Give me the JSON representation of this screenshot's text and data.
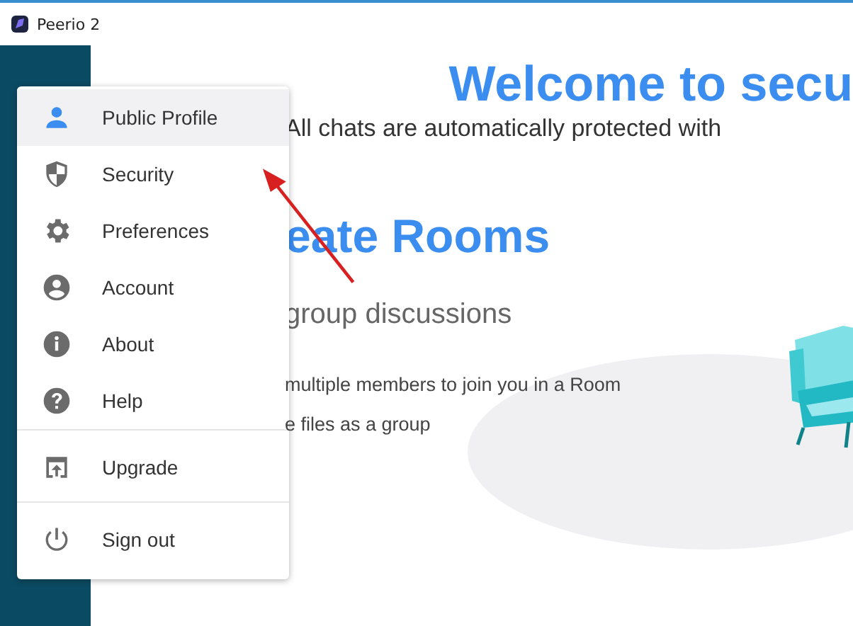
{
  "window": {
    "title": "Peerio 2"
  },
  "main": {
    "heading": "Welcome to secu",
    "subtitle": "All chats are automatically protected with",
    "section_heading": "eate Rooms",
    "section_subheading": "group discussions",
    "lines": [
      "multiple members to join you in a Room",
      "e files as a group"
    ]
  },
  "menu": {
    "sections": [
      [
        {
          "label": "Public Profile",
          "selected": true
        },
        {
          "label": "Security",
          "selected": false
        },
        {
          "label": "Preferences",
          "selected": false
        },
        {
          "label": "Account",
          "selected": false
        },
        {
          "label": "About",
          "selected": false
        },
        {
          "label": "Help",
          "selected": false
        }
      ],
      [
        {
          "label": "Upgrade",
          "selected": false
        }
      ],
      [
        {
          "label": "Sign out",
          "selected": false
        }
      ]
    ]
  }
}
